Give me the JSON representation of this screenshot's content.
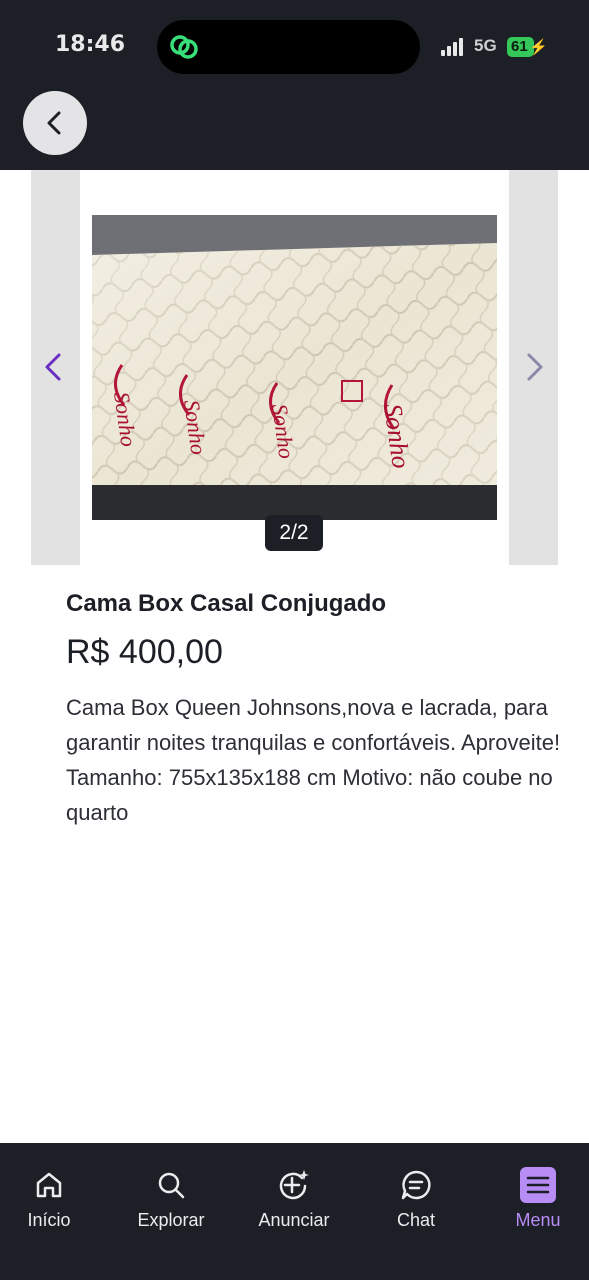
{
  "status_bar": {
    "time": "18:46",
    "network": "5G",
    "battery": "61"
  },
  "header": {
    "back_icon": "chevron-left-icon"
  },
  "carousel": {
    "counter": "2/2",
    "current_index": 2,
    "total": 2,
    "prev_icon": "chevron-left-icon",
    "next_icon": "chevron-right-icon",
    "image_label": "nosso Sonho"
  },
  "listing": {
    "title": "Cama Box Casal Conjugado",
    "price": "R$ 400,00",
    "description": "Cama Box Queen Johnsons,nova e lacrada, para garantir noites tranquilas e confortáveis. Aproveite! Tamanho: 755x135x188 cm Motivo: não coube no quarto"
  },
  "bottom_nav": {
    "items": [
      {
        "label": "Início",
        "icon": "home-icon"
      },
      {
        "label": "Explorar",
        "icon": "search-icon"
      },
      {
        "label": "Anunciar",
        "icon": "add-sparkle-icon"
      },
      {
        "label": "Chat",
        "icon": "chat-icon"
      },
      {
        "label": "Menu",
        "icon": "menu-icon"
      }
    ],
    "active": "Menu"
  },
  "colors": {
    "header_bg": "#1c1f26",
    "accent": "#b78cf4",
    "arrow_active": "#6a2ec2",
    "arrow_inactive": "#8a8aa8"
  }
}
